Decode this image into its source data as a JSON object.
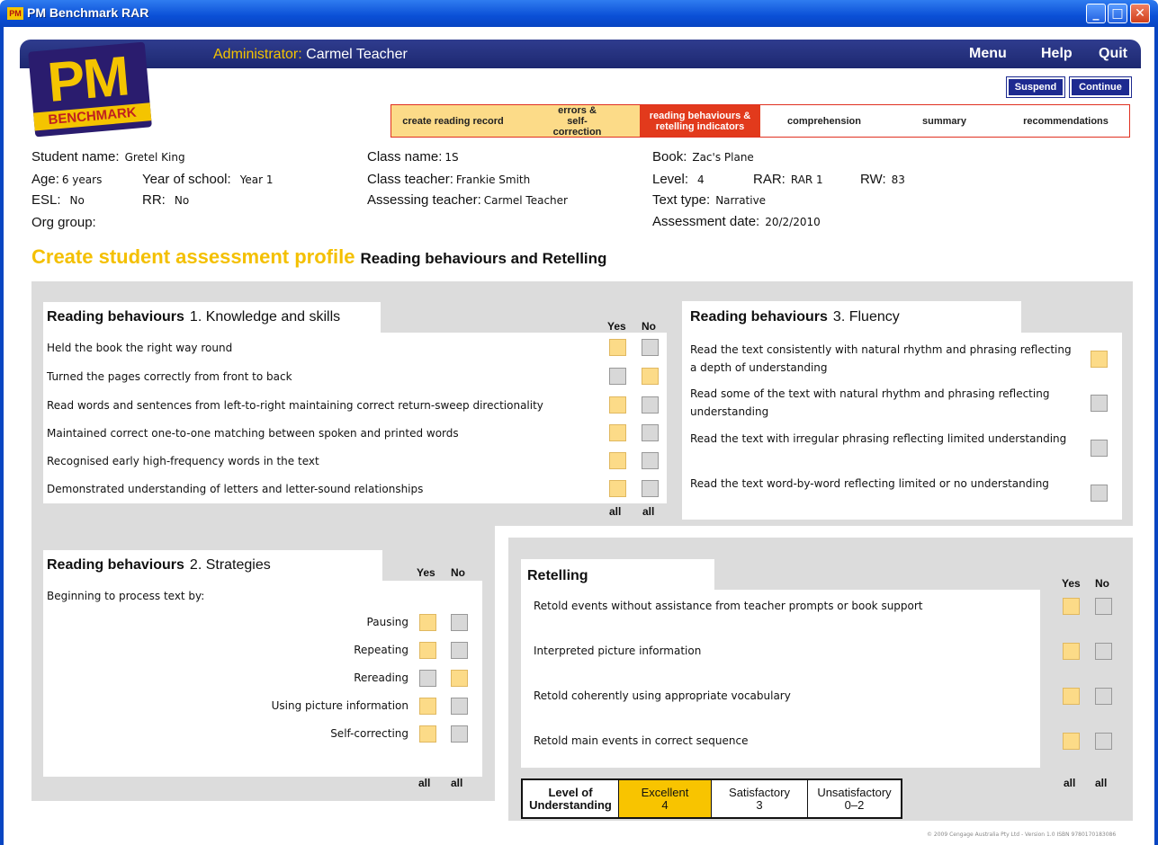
{
  "window": {
    "title": "PM Benchmark RAR",
    "icon_text": "PM"
  },
  "header": {
    "admin_label": "Administrator:",
    "admin_name": "Carmel Teacher",
    "menu": "Menu",
    "help": "Help",
    "quit": "Quit",
    "suspend": "Suspend",
    "continue": "Continue",
    "logo_top": "PM",
    "logo_bottom": "BENCHMARK"
  },
  "steps": [
    {
      "label": "create reading record",
      "state": "done"
    },
    {
      "label": "errors & self-correction",
      "state": "done"
    },
    {
      "label": "reading behaviours & retelling indicators",
      "state": "active"
    },
    {
      "label": "comprehension",
      "state": "todo"
    },
    {
      "label": "summary",
      "state": "todo"
    },
    {
      "label": "recommendations",
      "state": "todo"
    }
  ],
  "student": {
    "name_label": "Student name:",
    "name": "Gretel King",
    "age_label": "Age:",
    "age": "6 years",
    "year_label": "Year of school:",
    "year": "Year 1",
    "esl_label": "ESL:",
    "esl": "No",
    "rr_label": "RR:",
    "rr": "No",
    "org_label": "Org group:",
    "class_label": "Class name:",
    "class": "1S",
    "teacher_label": "Class teacher:",
    "teacher": "Frankie Smith",
    "assessor_label": "Assessing teacher:",
    "assessor": "Carmel Teacher",
    "book_label": "Book:",
    "book": "Zac's Plane",
    "level_label": "Level:",
    "level": "4",
    "rar_label": "RAR:",
    "rar": "RAR 1",
    "rw_label": "RW:",
    "rw": "83",
    "texttype_label": "Text type:",
    "texttype": "Narrative",
    "date_label": "Assessment date:",
    "date": "20/2/2010"
  },
  "page": {
    "title": "Create student assessment profile",
    "subtitle": "Reading behaviours and Retelling"
  },
  "labels": {
    "yes": "Yes",
    "no": "No",
    "all": "all"
  },
  "knowledge": {
    "title": "Reading behaviours",
    "sub": "1. Knowledge and skills",
    "items": [
      {
        "text": "Held the book the right way round",
        "yes": true,
        "no": false
      },
      {
        "text": "Turned the pages correctly from front to back",
        "yes": false,
        "no": true
      },
      {
        "text": "Read words and sentences from left-to-right maintaining correct return-sweep directionality",
        "yes": true,
        "no": false
      },
      {
        "text": "Maintained correct one-to-one matching between spoken and printed words",
        "yes": true,
        "no": false
      },
      {
        "text": "Recognised early high-frequency words in the text",
        "yes": true,
        "no": false
      },
      {
        "text": "Demonstrated understanding of letters and letter-sound relationships",
        "yes": true,
        "no": false
      }
    ]
  },
  "fluency": {
    "title": "Reading behaviours",
    "sub": "3. Fluency",
    "items": [
      {
        "text": "Read the text consistently with natural rhythm and phrasing reflecting a depth of understanding",
        "checked": true
      },
      {
        "text": "Read some of the text with natural rhythm and phrasing reflecting understanding",
        "checked": false
      },
      {
        "text": "Read the text with irregular phrasing reflecting limited understanding",
        "checked": false
      },
      {
        "text": "Read the text word-by-word reflecting limited or no understanding",
        "checked": false
      }
    ]
  },
  "strategies": {
    "title": "Reading behaviours",
    "sub": "2. Strategies",
    "intro": "Beginning to process text by:",
    "items": [
      {
        "text": "Pausing",
        "yes": true,
        "no": false
      },
      {
        "text": "Repeating",
        "yes": true,
        "no": false
      },
      {
        "text": "Rereading",
        "yes": false,
        "no": true
      },
      {
        "text": "Using picture information",
        "yes": true,
        "no": false
      },
      {
        "text": "Self-correcting",
        "yes": true,
        "no": false
      }
    ]
  },
  "retelling": {
    "title": "Retelling",
    "items": [
      {
        "text": "Retold events without assistance from teacher prompts or book support",
        "yes": true,
        "no": false
      },
      {
        "text": "Interpreted picture information",
        "yes": true,
        "no": false
      },
      {
        "text": "Retold coherently using appropriate vocabulary",
        "yes": true,
        "no": false
      },
      {
        "text": "Retold main events in correct sequence",
        "yes": true,
        "no": false
      }
    ]
  },
  "understanding": {
    "label": "Level of Understanding",
    "options": [
      {
        "name": "Excellent",
        "range": "4",
        "selected": true
      },
      {
        "name": "Satisfactory",
        "range": "3",
        "selected": false
      },
      {
        "name": "Unsatisfactory",
        "range": "0–2",
        "selected": false
      }
    ]
  },
  "footer": {
    "copyright": "© 2009 Cengage Australia Pty Ltd - Version 1.0 ISBN 9780170183086"
  },
  "colors": {
    "accent": "#f4c400",
    "active_step": "#e23a1c",
    "done_step": "#fcdb88",
    "navy": "#1d2a90",
    "checked": "#fcdb88"
  }
}
